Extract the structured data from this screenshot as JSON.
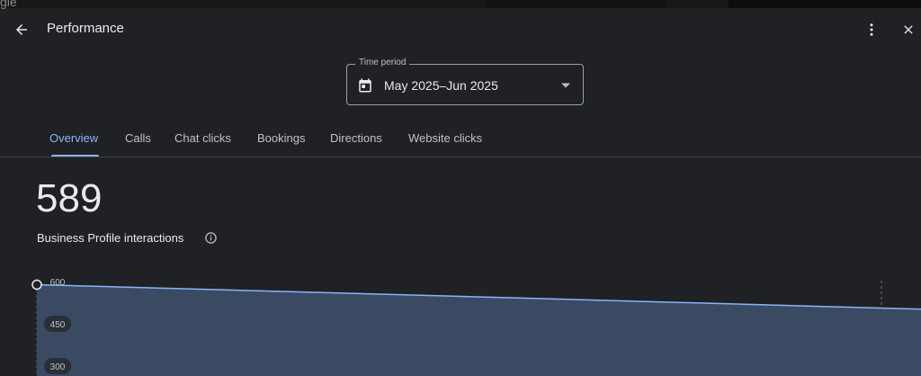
{
  "browser_strip": {
    "text": "gle"
  },
  "header": {
    "title": "Performance"
  },
  "time_period": {
    "label": "Time period",
    "value": "May 2025–Jun 2025"
  },
  "tabs": [
    {
      "label": "Overview",
      "active": true
    },
    {
      "label": "Calls",
      "active": false
    },
    {
      "label": "Chat clicks",
      "active": false
    },
    {
      "label": "Bookings",
      "active": false
    },
    {
      "label": "Directions",
      "active": false
    },
    {
      "label": "Website clicks",
      "active": false
    }
  ],
  "summary": {
    "total": "589",
    "label": "Business Profile interactions"
  },
  "colors": {
    "accent": "#8ab4f8",
    "background": "#202124",
    "area_fill": "#3b4a63",
    "line": "#8ab4f8"
  },
  "chart_data": {
    "type": "area",
    "y_ticks": [
      600,
      450,
      300
    ],
    "ylim": [
      0,
      600
    ],
    "x": [
      0,
      1
    ],
    "values": [
      589,
      460
    ],
    "grid": false
  }
}
